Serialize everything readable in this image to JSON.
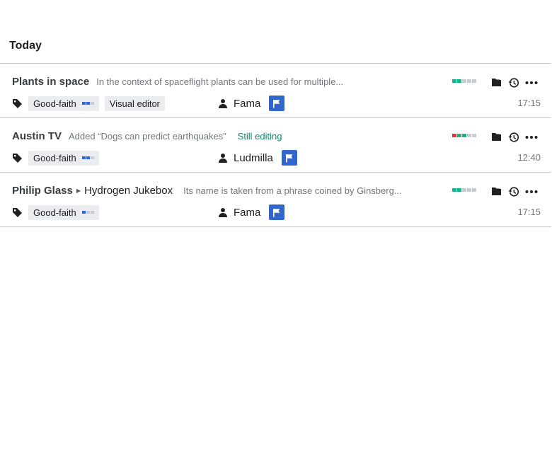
{
  "section": {
    "title": "Today"
  },
  "colors": {
    "accent_blue": "#3366cc",
    "status_green": "#14866d",
    "quality_green": "#14b38a",
    "quality_red": "#d33",
    "quality_empty": "#c8ccd1"
  },
  "rows": [
    {
      "title": "Plants in space",
      "summary": "In the context of spaceflight plants can be used for multiple...",
      "quality": [
        "filled",
        "filled",
        "empty",
        "empty",
        "empty"
      ],
      "tags": [
        "Good-faith",
        "Visual editor"
      ],
      "good_faith_level": 2,
      "user": "Fama",
      "time": "17:15"
    },
    {
      "title": "Austin TV",
      "summary": "Added “Dogs can predict earthquakes”",
      "status": "Still editing",
      "quality": [
        "red",
        "filled",
        "filled",
        "empty",
        "empty"
      ],
      "tags": [
        "Good-faith"
      ],
      "good_faith_level": 2,
      "user": "Ludmilla",
      "time": "12:40"
    },
    {
      "title_parent": "Philip Glass",
      "title_child": "Hydrogen Jukebox",
      "summary": "Its name is taken from a phrase coined by Ginsberg...",
      "quality": [
        "filled",
        "filled",
        "empty",
        "empty",
        "empty"
      ],
      "tags": [
        "Good-faith"
      ],
      "good_faith_level": 1,
      "user": "Fama",
      "time": "17:15"
    }
  ],
  "icons": {
    "tag": "tag-icon",
    "user": "user-icon",
    "flag": "flag-icon",
    "folder": "folder-icon",
    "history": "history-icon",
    "more": "more-icon",
    "breadcrumb": "caret-right-icon"
  }
}
